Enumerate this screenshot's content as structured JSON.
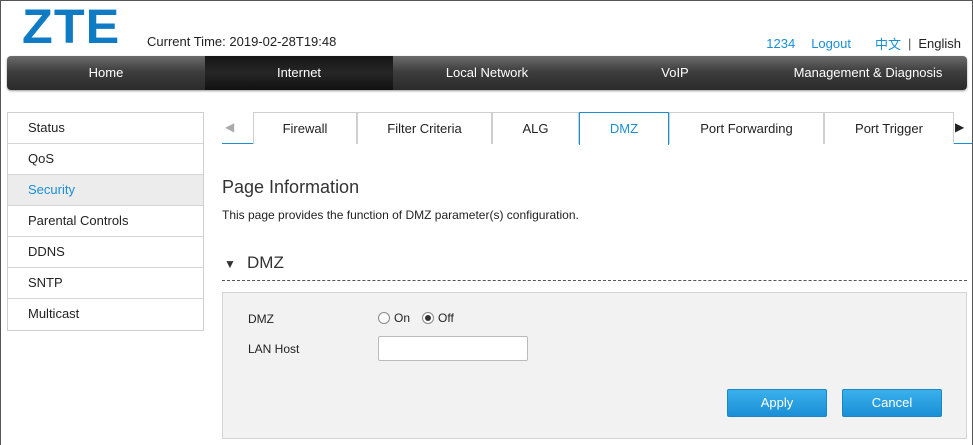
{
  "header": {
    "logo_text": "ZTE",
    "current_time_label": "Current Time:",
    "current_time_value": "2019-02-28T19:48",
    "user": "1234",
    "logout": "Logout",
    "lang_zh": "中文",
    "lang_sep": "|",
    "lang_en": "English",
    "brand_color": "#0f7bc4"
  },
  "main_nav": [
    {
      "label": "Home",
      "active": false
    },
    {
      "label": "Internet",
      "active": true
    },
    {
      "label": "Local Network",
      "active": false
    },
    {
      "label": "VoIP",
      "active": false
    },
    {
      "label": "Management & Diagnosis",
      "active": false
    }
  ],
  "sidebar": [
    {
      "label": "Status",
      "active": false
    },
    {
      "label": "QoS",
      "active": false
    },
    {
      "label": "Security",
      "active": true
    },
    {
      "label": "Parental Controls",
      "active": false
    },
    {
      "label": "DDNS",
      "active": false
    },
    {
      "label": "SNTP",
      "active": false
    },
    {
      "label": "Multicast",
      "active": false
    }
  ],
  "tabs": [
    {
      "label": "Firewall",
      "active": false
    },
    {
      "label": "Filter Criteria",
      "active": false
    },
    {
      "label": "ALG",
      "active": false
    },
    {
      "label": "DMZ",
      "active": true
    },
    {
      "label": "Port Forwarding",
      "active": false
    },
    {
      "label": "Port Trigger",
      "active": false
    }
  ],
  "tab_icons": {
    "left": "triangle-left-icon",
    "right": "triangle-right-icon"
  },
  "page": {
    "title": "Page Information",
    "description": "This page provides the function of DMZ parameter(s) configuration."
  },
  "section": {
    "title": "DMZ",
    "icon": "triangle-down-icon"
  },
  "form": {
    "dmz_label": "DMZ",
    "dmz_on_label": "On",
    "dmz_off_label": "Off",
    "dmz_value": "Off",
    "lan_host_label": "LAN Host",
    "lan_host_value": "",
    "apply_label": "Apply",
    "cancel_label": "Cancel"
  },
  "colors": {
    "accent": "#1a8fd6",
    "nav_dark": "#2a2a2a"
  }
}
